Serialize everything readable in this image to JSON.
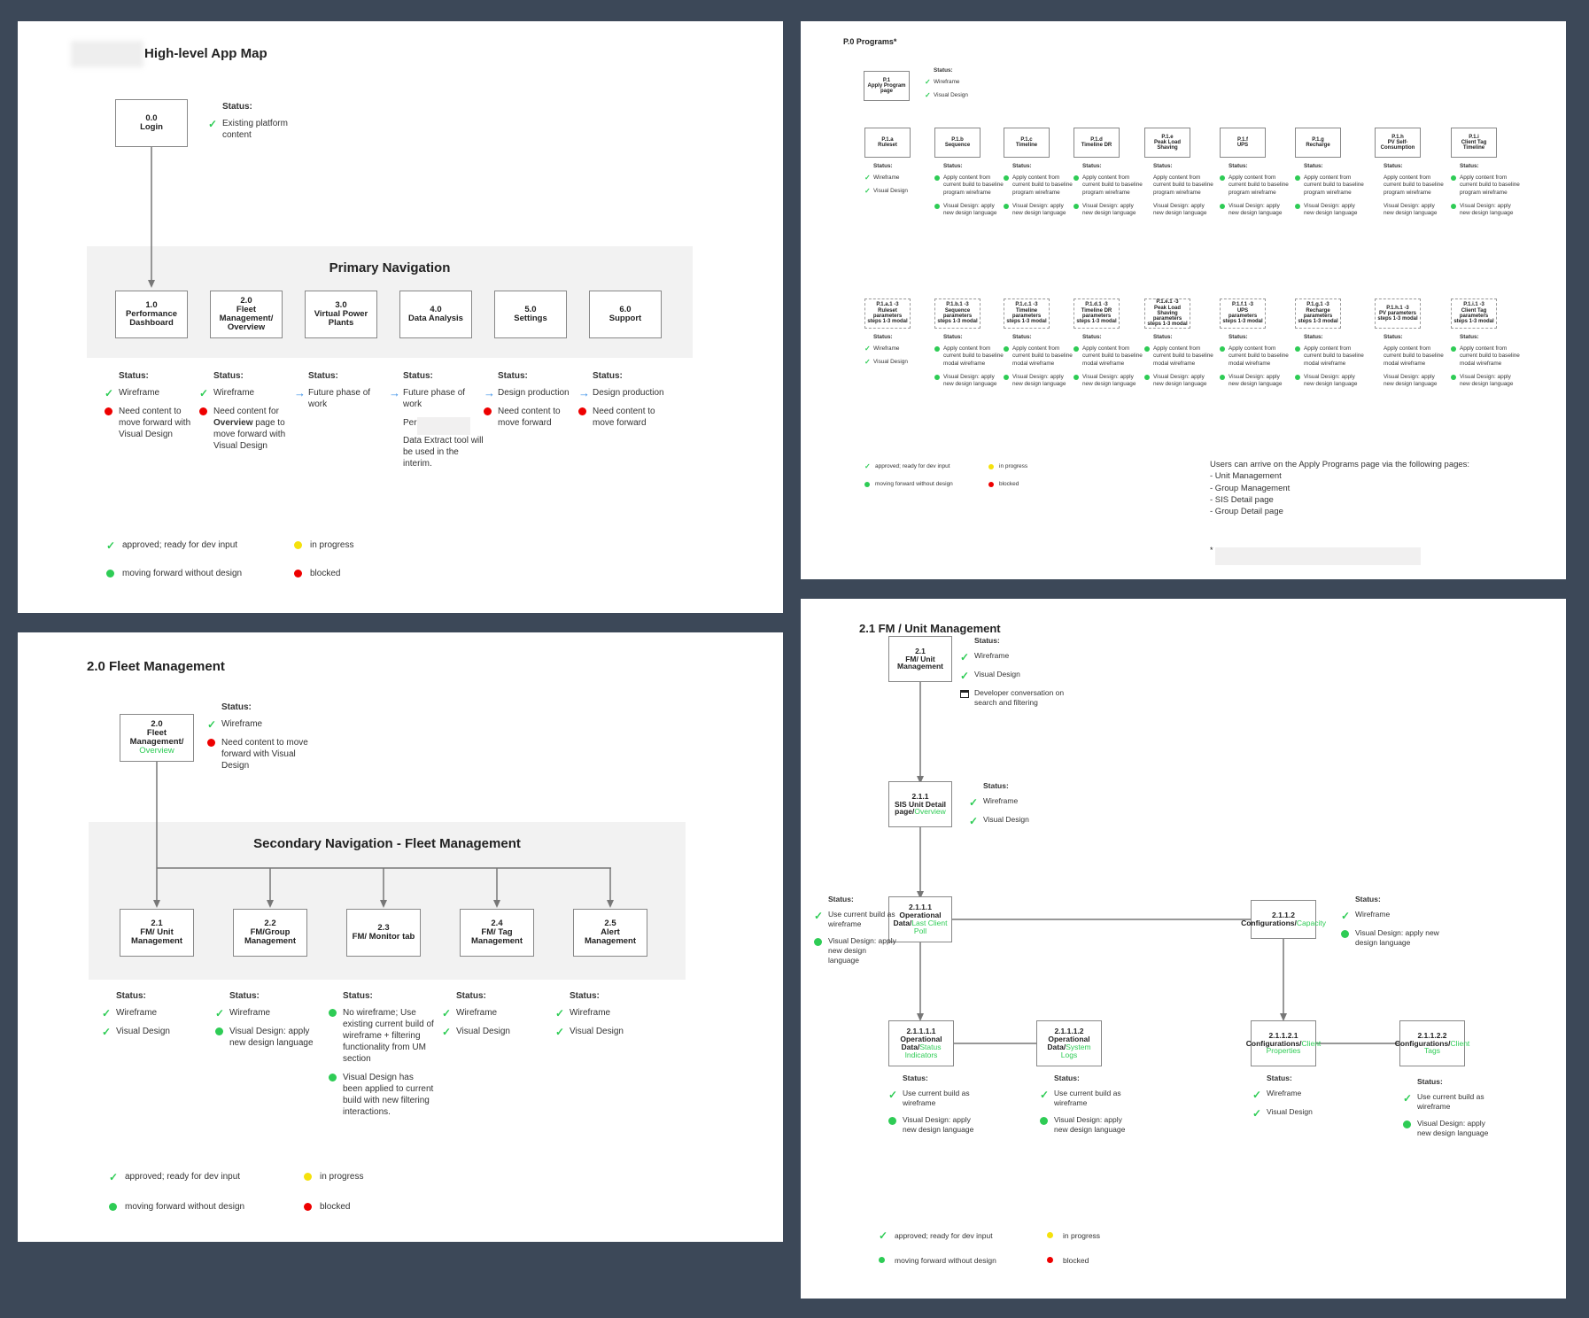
{
  "legend": {
    "approved": "approved; ready for dev input",
    "in_progress": "in progress",
    "moving_forward": "moving forward without design",
    "blocked": "blocked"
  },
  "colors": {
    "background": "#3c4858",
    "check": "#2ecc55",
    "green_dot": "#2ecc55",
    "yellow_dot": "#f5e10c",
    "red_dot": "#ee0000",
    "arrow": "#3a8fe8",
    "band": "#f2f2f2",
    "link_text": "#2ecc55"
  },
  "app_map": {
    "title": "High-level App Map",
    "login": {
      "num": "0.0",
      "name": "Login"
    },
    "login_status": {
      "heading": "Status:",
      "items": [
        {
          "icon": "check-icon",
          "text": "Existing platform content"
        }
      ]
    },
    "band_title": "Primary Navigation",
    "nodes": [
      {
        "num": "1.0",
        "name": "Performance Dashboard"
      },
      {
        "num": "2.0",
        "name": "Fleet Management/ Overview"
      },
      {
        "num": "3.0",
        "name": "Virtual Power Plants"
      },
      {
        "num": "4.0",
        "name": "Data Analysis"
      },
      {
        "num": "5.0",
        "name": "Settings"
      },
      {
        "num": "6.0",
        "name": "Support"
      }
    ],
    "statuses": [
      {
        "heading": "Status:",
        "items": [
          {
            "icon": "check-icon",
            "text": "Wireframe"
          },
          {
            "icon": "red-dot-icon",
            "text": "Need content to move forward with Visual Design"
          }
        ]
      },
      {
        "heading": "Status:",
        "items": [
          {
            "icon": "check-icon",
            "text": "Wireframe"
          },
          {
            "icon": "red-dot-icon",
            "pre": "Need content for ",
            "bold": "Overview",
            "post": " page to move forward with Visual Design"
          }
        ]
      },
      {
        "heading": "Status:",
        "items": [
          {
            "icon": "arrow-right-icon",
            "text": "Future phase of work"
          }
        ]
      },
      {
        "heading": "Status:",
        "items": [
          {
            "icon": "arrow-right-icon",
            "text": "Future phase of work"
          },
          {
            "icon": "none",
            "pre": "Per",
            "post": "Data Extract tool will be used in the interim."
          }
        ]
      },
      {
        "heading": "Status:",
        "items": [
          {
            "icon": "arrow-right-icon",
            "text": "Design production"
          },
          {
            "icon": "red-dot-icon",
            "text": "Need content to move forward"
          }
        ]
      },
      {
        "heading": "Status:",
        "items": [
          {
            "icon": "arrow-right-icon",
            "text": "Design production"
          },
          {
            "icon": "red-dot-icon",
            "text": "Need content to move forward"
          }
        ]
      }
    ]
  },
  "programs": {
    "title": "P.0 Programs*",
    "apply": {
      "num": "P.1",
      "name": "Apply Program page"
    },
    "apply_status": {
      "heading": "Status:",
      "items": [
        {
          "icon": "check-icon",
          "text": "Wireframe"
        },
        {
          "icon": "check-icon",
          "text": "Visual Design"
        }
      ]
    },
    "row1": [
      {
        "num": "P.1.a",
        "name": "Ruleset"
      },
      {
        "num": "P.1.b",
        "name": "Sequence"
      },
      {
        "num": "P.1.c",
        "name": "Timeline"
      },
      {
        "num": "P.1.d",
        "name": "Timeline DR"
      },
      {
        "num": "P.1.e",
        "name": "Peak Load Shaving"
      },
      {
        "num": "P.1.f",
        "name": "UPS"
      },
      {
        "num": "P.1.g",
        "name": "Recharge"
      },
      {
        "num": "P.1.h",
        "name": "PV Self-Consumption"
      },
      {
        "num": "P.1.i",
        "name": "Client Tag Timeline"
      }
    ],
    "row1_status": [
      {
        "heading": "Status:",
        "items": [
          {
            "icon": "check-icon",
            "text": "Wireframe"
          },
          {
            "icon": "check-icon",
            "text": "Visual Design"
          }
        ]
      },
      {
        "heading": "Status:",
        "items": [
          {
            "icon": "green-dot-icon",
            "text": "Apply content from current build to baseline program wireframe"
          },
          {
            "icon": "green-dot-icon",
            "text": "Visual Design: apply new design language"
          }
        ]
      },
      {
        "heading": "Status:",
        "items": [
          {
            "icon": "green-dot-icon",
            "text": "Apply content from current build to baseline program wireframe"
          },
          {
            "icon": "green-dot-icon",
            "text": "Visual Design: apply new design language"
          }
        ]
      },
      {
        "heading": "Status:",
        "items": [
          {
            "icon": "green-dot-icon",
            "text": "Apply content from current build to baseline program wireframe"
          },
          {
            "icon": "green-dot-icon",
            "text": "Visual Design: apply new design language"
          }
        ]
      },
      {
        "heading": "Status:",
        "items": [
          {
            "icon": "none",
            "text": "Apply content from current build to baseline program wireframe"
          },
          {
            "icon": "none",
            "text": "Visual Design: apply new design language"
          }
        ]
      },
      {
        "heading": "Status:",
        "items": [
          {
            "icon": "green-dot-icon",
            "text": "Apply content from current build to baseline program wireframe"
          },
          {
            "icon": "green-dot-icon",
            "text": "Visual Design: apply new design language"
          }
        ]
      },
      {
        "heading": "Status:",
        "items": [
          {
            "icon": "green-dot-icon",
            "text": "Apply content from current build to baseline program wireframe"
          },
          {
            "icon": "green-dot-icon",
            "text": "Visual Design: apply new design language"
          }
        ]
      },
      {
        "heading": "Status:",
        "items": [
          {
            "icon": "none",
            "text": "Apply content from current build to baseline program wireframe"
          },
          {
            "icon": "none",
            "text": "Visual Design: apply new design language"
          }
        ]
      },
      {
        "heading": "Status:",
        "items": [
          {
            "icon": "green-dot-icon",
            "text": "Apply content from current build to baseline program wireframe"
          },
          {
            "icon": "green-dot-icon",
            "text": "Visual Design: apply new design language"
          }
        ]
      }
    ],
    "row2": [
      {
        "num": "P.1.a.1 -3",
        "name": "Ruleset parameters steps 1-3 modal"
      },
      {
        "num": "P.1.b.1 -3",
        "name": "Sequence parameters steps 1-3 modal"
      },
      {
        "num": "P.1.c.1 -3",
        "name": "Timeline parameters steps 1-3 modal"
      },
      {
        "num": "P.1.d.1 -3",
        "name": "Timeline DR parameters steps 1-3 modal"
      },
      {
        "num": "P.1.e.1 -3",
        "name": "Peak Load Shaving parameters steps 1-3 modal"
      },
      {
        "num": "P.1.f.1 -3",
        "name": "UPS parameters steps 1-3 modal"
      },
      {
        "num": "P.1.g.1 -3",
        "name": "Recharge parameters steps 1-3 modal"
      },
      {
        "num": "P.1.h.1 -3",
        "name": "PV parameters steps 1-3 modal"
      },
      {
        "num": "P.1.i.1 -3",
        "name": "Client Tag parameters steps 1-3 modal"
      }
    ],
    "row2_status": [
      {
        "heading": "Status:",
        "items": [
          {
            "icon": "check-icon",
            "text": "Wireframe"
          },
          {
            "icon": "check-icon",
            "text": "Visual Design"
          }
        ]
      },
      {
        "heading": "Status:",
        "items": [
          {
            "icon": "green-dot-icon",
            "text": "Apply content from current build to baseline modal wireframe"
          },
          {
            "icon": "green-dot-icon",
            "text": "Visual Design: apply new design language"
          }
        ]
      },
      {
        "heading": "Status:",
        "items": [
          {
            "icon": "green-dot-icon",
            "text": "Apply content from current build to baseline modal wireframe"
          },
          {
            "icon": "green-dot-icon",
            "text": "Visual Design: apply new design language"
          }
        ]
      },
      {
        "heading": "Status:",
        "items": [
          {
            "icon": "green-dot-icon",
            "text": "Apply content from current build to baseline modal wireframe"
          },
          {
            "icon": "green-dot-icon",
            "text": "Visual Design: apply new design language"
          }
        ]
      },
      {
        "heading": "Status:",
        "items": [
          {
            "icon": "green-dot-icon",
            "text": "Apply content from current build to baseline modal wireframe"
          },
          {
            "icon": "green-dot-icon",
            "text": "Visual Design: apply new design language"
          }
        ]
      },
      {
        "heading": "Status:",
        "items": [
          {
            "icon": "green-dot-icon",
            "text": "Apply content from current build to baseline modal wireframe"
          },
          {
            "icon": "green-dot-icon",
            "text": "Visual Design: apply new design language"
          }
        ]
      },
      {
        "heading": "Status:",
        "items": [
          {
            "icon": "green-dot-icon",
            "text": "Apply content from current build to baseline modal wireframe"
          },
          {
            "icon": "green-dot-icon",
            "text": "Visual Design: apply new design language"
          }
        ]
      },
      {
        "heading": "Status:",
        "items": [
          {
            "icon": "none",
            "text": "Apply content from current build to baseline modal wireframe"
          },
          {
            "icon": "none",
            "text": "Visual Design: apply new design language"
          }
        ]
      },
      {
        "heading": "Status:",
        "items": [
          {
            "icon": "green-dot-icon",
            "text": "Apply content from current build to baseline modal wireframe"
          },
          {
            "icon": "green-dot-icon",
            "text": "Visual Design: apply new design language"
          }
        ]
      }
    ],
    "note_heading": "Users can arrive on the Apply Programs page via the following pages:",
    "note_items": [
      "- Unit Management",
      "- Group Management",
      "- SIS Detail page",
      "- Group Detail page"
    ],
    "footnote_marker": "*"
  },
  "fleet": {
    "title": "2.0 Fleet Management",
    "root": {
      "num": "2.0",
      "name": "Fleet Management/",
      "link": "Overview"
    },
    "root_status": {
      "heading": "Status:",
      "items": [
        {
          "icon": "check-icon",
          "text": "Wireframe"
        },
        {
          "icon": "red-dot-icon",
          "text": "Need content to move forward with Visual Design"
        }
      ]
    },
    "band_title": "Secondary Navigation - Fleet Management",
    "nodes": [
      {
        "num": "2.1",
        "name": "FM/ Unit Management"
      },
      {
        "num": "2.2",
        "name": "FM/Group Management"
      },
      {
        "num": "2.3",
        "name": "FM/ Monitor tab"
      },
      {
        "num": "2.4",
        "name": "FM/ Tag Management"
      },
      {
        "num": "2.5",
        "name": "Alert Management"
      }
    ],
    "statuses": [
      {
        "heading": "Status:",
        "items": [
          {
            "icon": "check-icon",
            "text": "Wireframe"
          },
          {
            "icon": "check-icon",
            "text": "Visual Design"
          }
        ]
      },
      {
        "heading": "Status:",
        "items": [
          {
            "icon": "check-icon",
            "text": "Wireframe"
          },
          {
            "icon": "green-dot-icon",
            "text": "Visual Design: apply new design language"
          }
        ]
      },
      {
        "heading": "Status:",
        "items": [
          {
            "icon": "green-dot-icon",
            "text": "No wireframe; Use existing current build of wireframe + filtering functionality from UM section"
          },
          {
            "icon": "green-dot-icon",
            "text": "Visual Design has been applied to current build with new filtering interactions."
          }
        ]
      },
      {
        "heading": "Status:",
        "items": [
          {
            "icon": "check-icon",
            "text": "Wireframe"
          },
          {
            "icon": "check-icon",
            "text": "Visual Design"
          }
        ]
      },
      {
        "heading": "Status:",
        "items": [
          {
            "icon": "check-icon",
            "text": "Wireframe"
          },
          {
            "icon": "check-icon",
            "text": "Visual Design"
          }
        ]
      }
    ]
  },
  "unit_mgmt": {
    "title": "2.1 FM / Unit Management",
    "n21": {
      "num": "2.1",
      "name": "FM/ Unit Management",
      "link": ""
    },
    "n21_status": {
      "heading": "Status:",
      "items": [
        {
          "icon": "check-icon",
          "text": "Wireframe"
        },
        {
          "icon": "check-icon",
          "text": "Visual Design"
        },
        {
          "icon": "calendar-icon",
          "text": "Developer conversation on search and filtering"
        }
      ]
    },
    "n211": {
      "num": "2.1.1",
      "name": "SIS Unit Detail page/",
      "link": "Overview"
    },
    "n211_status": {
      "heading": "Status:",
      "items": [
        {
          "icon": "check-icon",
          "text": "Wireframe"
        },
        {
          "icon": "check-icon",
          "text": "Visual Design"
        }
      ]
    },
    "n2111": {
      "num": "2.1.1.1",
      "name": "Operational Data/",
      "link": "Last Client Poll"
    },
    "n2111_status": {
      "heading": "Status:",
      "items": [
        {
          "icon": "check-icon",
          "text": "Use current build as wireframe"
        },
        {
          "icon": "green-dot-icon",
          "text": "Visual Design: apply new design language"
        }
      ]
    },
    "n2112": {
      "num": "2.1.1.2",
      "name": "Configurations/",
      "link": "Capacity"
    },
    "n2112_status": {
      "heading": "Status:",
      "items": [
        {
          "icon": "check-icon",
          "text": "Wireframe"
        },
        {
          "icon": "green-dot-icon",
          "text": "Visual Design: apply new design language"
        }
      ]
    },
    "n21111": {
      "num": "2.1.1.1.1",
      "name": "Operational Data/",
      "link": "Status Indicators"
    },
    "n21111_status": {
      "heading": "Status:",
      "items": [
        {
          "icon": "check-icon",
          "text": "Use current build as wireframe"
        },
        {
          "icon": "green-dot-icon",
          "text": "Visual Design: apply new design language"
        }
      ]
    },
    "n21112": {
      "num": "2.1.1.1.2",
      "name": "Operational Data/",
      "link": "System Logs"
    },
    "n21112_status": {
      "heading": "Status:",
      "items": [
        {
          "icon": "check-icon",
          "text": "Use current build as wireframe"
        },
        {
          "icon": "green-dot-icon",
          "text": "Visual Design: apply new design language"
        }
      ]
    },
    "n21121": {
      "num": "2.1.1.2.1",
      "name": "Configurations/",
      "link": "Client Properties"
    },
    "n21121_status": {
      "heading": "Status:",
      "items": [
        {
          "icon": "check-icon",
          "text": "Wireframe"
        },
        {
          "icon": "check-icon",
          "text": "Visual Design"
        }
      ]
    },
    "n21122": {
      "num": "2.1.1.2.2",
      "name": "Configurations/",
      "link": "Client Tags"
    },
    "n21122_status": {
      "heading": "Status:",
      "items": [
        {
          "icon": "check-icon",
          "text": "Use current build as wireframe"
        },
        {
          "icon": "green-dot-icon",
          "text": "Visual Design: apply new design language"
        }
      ]
    }
  }
}
